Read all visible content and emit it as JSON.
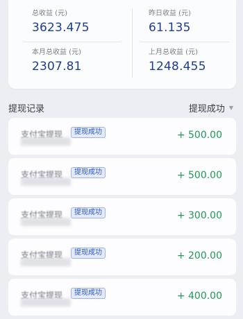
{
  "stats": {
    "total": {
      "label": "总收益 (元)",
      "value": "3623.475"
    },
    "yesterday": {
      "label": "昨日收益 (元)",
      "value": "61.135"
    },
    "this_month": {
      "label": "本月总收益 (元)",
      "value": "2307.81"
    },
    "last_month": {
      "label": "上月总收益 (元)",
      "value": "1248.455"
    }
  },
  "records": {
    "title": "提现记录",
    "filter_label": "提现成功",
    "items": [
      {
        "method": "支付宝提现",
        "status": "提现成功",
        "amount": "+ 500.00"
      },
      {
        "method": "支付宝提现",
        "status": "提现成功",
        "amount": "+ 500.00"
      },
      {
        "method": "支付宝提现",
        "status": "提现成功",
        "amount": "+ 300.00"
      },
      {
        "method": "支付宝提现",
        "status": "提现成功",
        "amount": "+ 200.00"
      },
      {
        "method": "支付宝提现",
        "status": "提现成功",
        "amount": "+ 400.00"
      }
    ]
  },
  "colors": {
    "value": "#1f3d8f",
    "amount": "#1f9a55",
    "badge": "#2b56c6"
  }
}
